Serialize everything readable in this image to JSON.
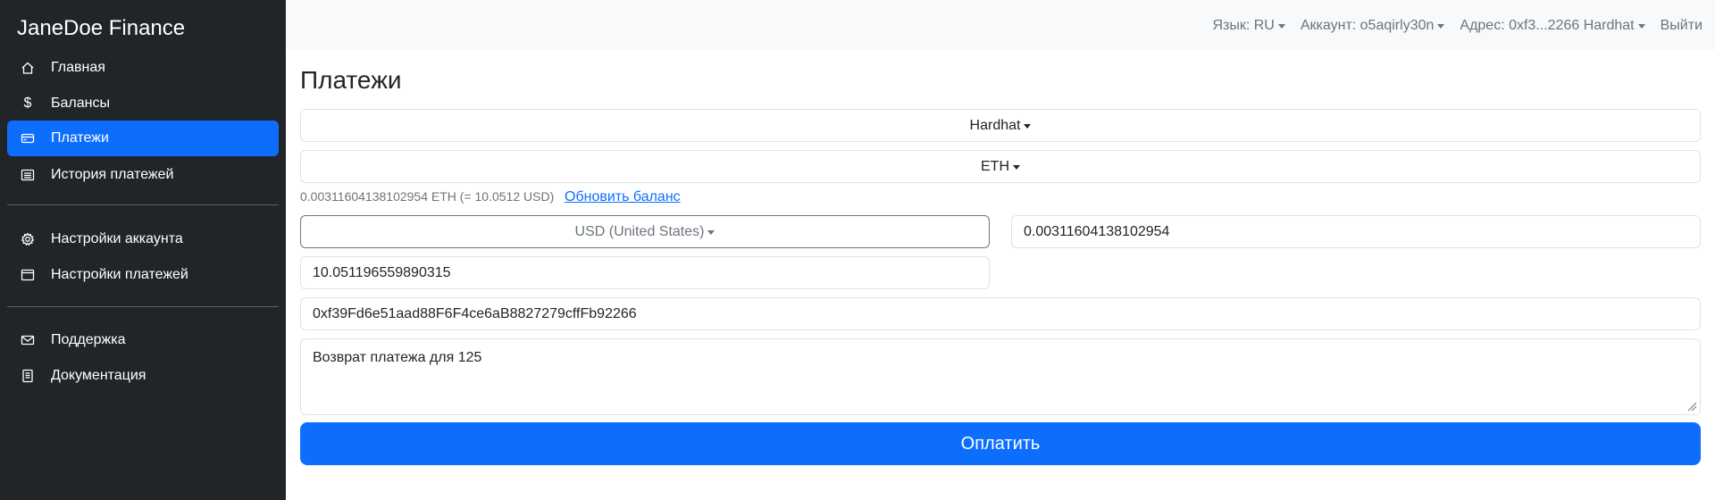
{
  "sidebar": {
    "brand": "JaneDoe Finance",
    "items": [
      {
        "label": "Главная",
        "icon": "home-icon"
      },
      {
        "label": "Балансы",
        "icon": "dollar-icon"
      },
      {
        "label": "Платежи",
        "icon": "credit-card-icon",
        "active": true
      },
      {
        "label": "История платежей",
        "icon": "list-icon"
      },
      {
        "label": "Настройки аккаунта",
        "icon": "gear-icon"
      },
      {
        "label": "Настройки платежей",
        "icon": "window-icon"
      },
      {
        "label": "Поддержка",
        "icon": "envelope-icon"
      },
      {
        "label": "Документация",
        "icon": "document-icon"
      }
    ]
  },
  "topbar": {
    "language": "Язык: RU",
    "account": "Аккаунт: o5aqirly30n",
    "address": "Адрес: 0xf3...2266 Hardhat",
    "logout": "Выйти"
  },
  "main": {
    "title": "Платежи",
    "network_select": "Hardhat",
    "token_select": "ETH",
    "balance_text": "0.00311604138102954 ETH (= 10.0512 USD)",
    "refresh_link": "Обновить баланс",
    "currency_select": "USD (United States)",
    "token_amount": "0.00311604138102954",
    "fiat_amount": "10.051196559890315",
    "recipient_address": "0xf39Fd6e51aad88F6F4ce6aB8827279cffFb92266",
    "description": "Возврат платежа для 125",
    "pay_button": "Оплатить"
  },
  "colors": {
    "sidebar_bg": "#212529",
    "accent": "#0d6efd",
    "topbar_bg": "#f8f9fa",
    "muted_text": "#6c757d"
  }
}
